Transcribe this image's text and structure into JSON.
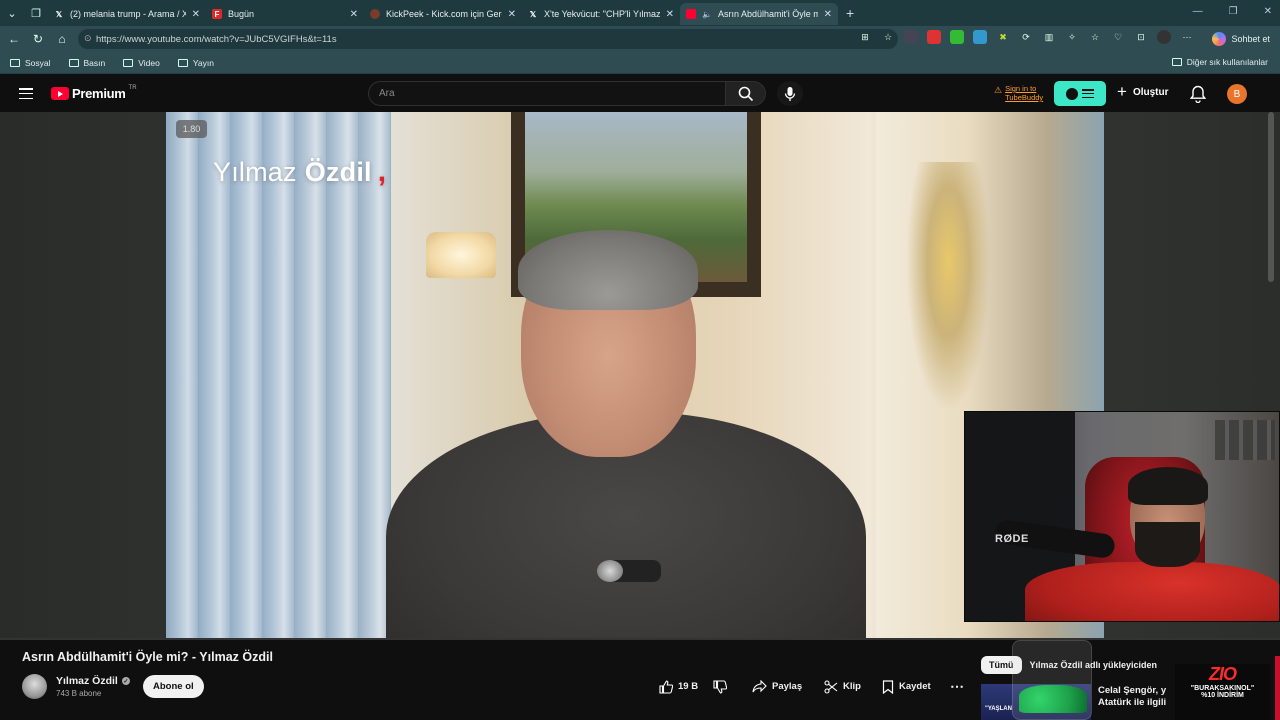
{
  "browser": {
    "tabs": [
      {
        "title": "(2) melania trump - Arama / X",
        "favicon": "x-icon",
        "active": false
      },
      {
        "title": "Bugün",
        "favicon": "flipboard-icon",
        "active": false
      },
      {
        "title": "KickPeek - Kick.com için Gerçek Za",
        "favicon": "kickpeek-icon",
        "active": false
      },
      {
        "title": "X'te Yekvücut: \"CHP'li Yılmaz Ö",
        "favicon": "x-icon",
        "active": false
      },
      {
        "title": "Asrın Abdülhamit'i Öyle mi? -",
        "favicon": "youtube-icon",
        "active": true
      }
    ],
    "url": "https://www.youtube.com/watch?v=JUbC5VGIFHs&t=11s",
    "chat_label": "Sohbet et",
    "bookmarks": [
      "Sosyal",
      "Basın",
      "Video",
      "Yayın"
    ],
    "other_bookmarks": "Diğer sık kullanılanlar"
  },
  "header": {
    "logo_text": "Premium",
    "logo_region": "TR",
    "search_placeholder": "Ara",
    "tubebuddy_line1": "Sign in to",
    "tubebuddy_line2": "TubeBuddy",
    "create_label": "Oluştur",
    "avatar_letter": "B"
  },
  "player": {
    "speed_badge": "1.80",
    "overlay_first": "Yılmaz",
    "overlay_last": "Özdil",
    "overlay_mark": ","
  },
  "webcam": {
    "mic_brand": "RØDE"
  },
  "video_info": {
    "title": "Asrın Abdülhamit'i Öyle mi? - Yılmaz Özdil",
    "channel": "Yılmaz Özdil",
    "subscribers": "743 B abone",
    "subscribe_label": "Abone ol",
    "likes": "19 B",
    "share_label": "Paylaş",
    "clip_label": "Klip",
    "save_label": "Kaydet",
    "more_label": "⋯"
  },
  "sidebar": {
    "chip_all": "Tümü",
    "chip_uploader": "Yılmaz Özdil adlı yükleyiciden",
    "rec_title": "Celal Şengör, y Atatürk ile ilgili",
    "rec_thumb_text": "\"YAŞLAN"
  },
  "promo": {
    "logo": "ZIO",
    "line1": "\"BURAKSAKINOL\"",
    "line2": "%10 İNDİRİM"
  },
  "colors": {
    "accent_red": "#ff0033",
    "tubebuddy": "#3ce6c6",
    "chrome_bg": "#1e3a3f"
  }
}
